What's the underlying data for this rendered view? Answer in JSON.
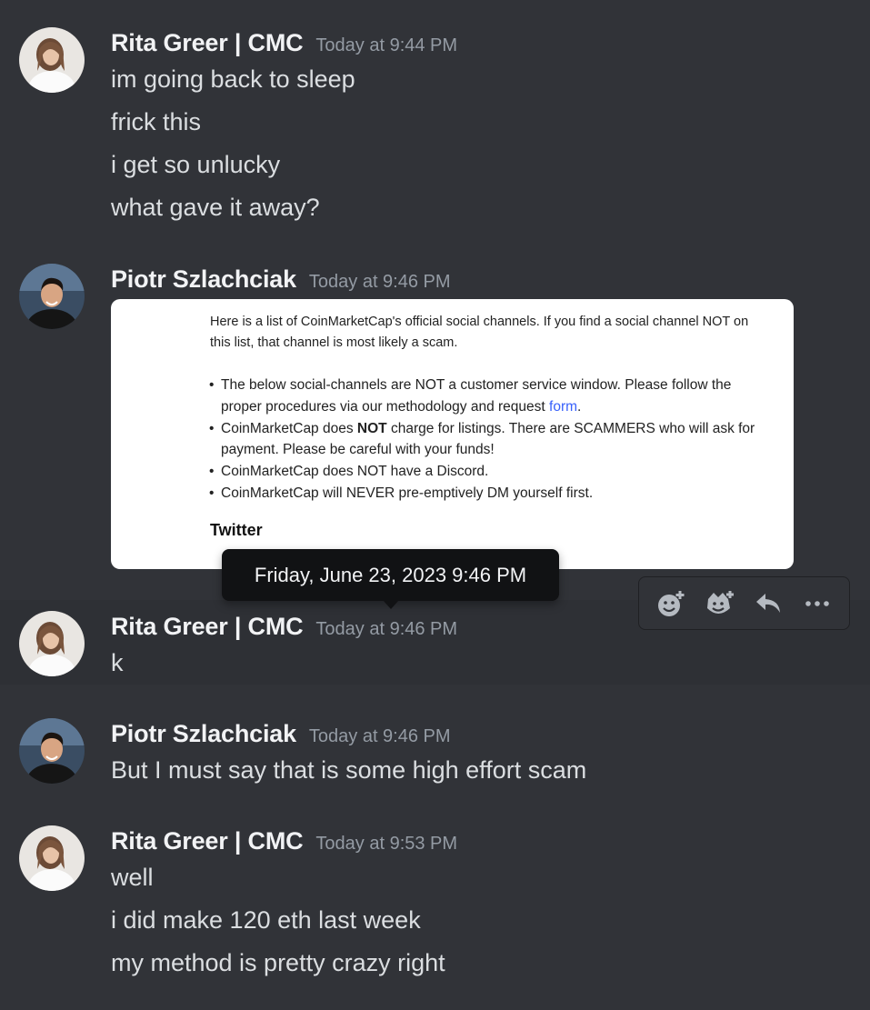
{
  "users": {
    "rita": {
      "name": "Rita Greer | CMC"
    },
    "piotr": {
      "name": "Piotr Szlachciak"
    }
  },
  "messages": [
    {
      "author": "Rita Greer | CMC",
      "timestamp": "Today at 9:44 PM",
      "lines": [
        "im going back to sleep",
        "frick this",
        "i get so unlucky",
        "what gave it away?"
      ]
    },
    {
      "author": "Piotr Szlachciak",
      "timestamp": "Today at 9:46 PM",
      "embed": {
        "intro": "Here is a list of CoinMarketCap's official social channels. If you find a social channel NOT on this list, that channel is most likely a scam.",
        "bullets": [
          {
            "before": "The below social-channels are NOT a customer service window. Please follow the proper procedures via our methodology and request ",
            "link": "form",
            "after": "."
          },
          {
            "before": "CoinMarketCap does ",
            "bold": "NOT",
            "after": " charge for listings. There are SCAMMERS who will ask for payment. Please be careful with your funds!"
          },
          {
            "text": "CoinMarketCap does NOT have a Discord."
          },
          {
            "text": "CoinMarketCap will NEVER pre-emptively DM yourself first."
          }
        ],
        "heading": "Twitter"
      }
    },
    {
      "author": "Rita Greer | CMC",
      "timestamp": "Today at 9:46 PM",
      "lines": [
        "k"
      ]
    },
    {
      "author": "Piotr Szlachciak",
      "timestamp": "Today at 9:46 PM",
      "lines": [
        "But I must say that is some high effort scam"
      ]
    },
    {
      "author": "Rita Greer | CMC",
      "timestamp": "Today at 9:53 PM",
      "lines": [
        "well",
        "i did make 120 eth last week",
        "my method is pretty crazy right"
      ]
    }
  ],
  "tooltip": {
    "text": "Friday, June 23, 2023 9:46 PM"
  },
  "action_bar": {
    "icons": [
      "add-reaction-icon",
      "add-super-reaction-icon",
      "reply-icon",
      "more-options-icon"
    ]
  },
  "colors": {
    "background": "#313338",
    "hover_background": "#2e3035",
    "link": "#3861fb",
    "timestamp": "#949ba4"
  }
}
